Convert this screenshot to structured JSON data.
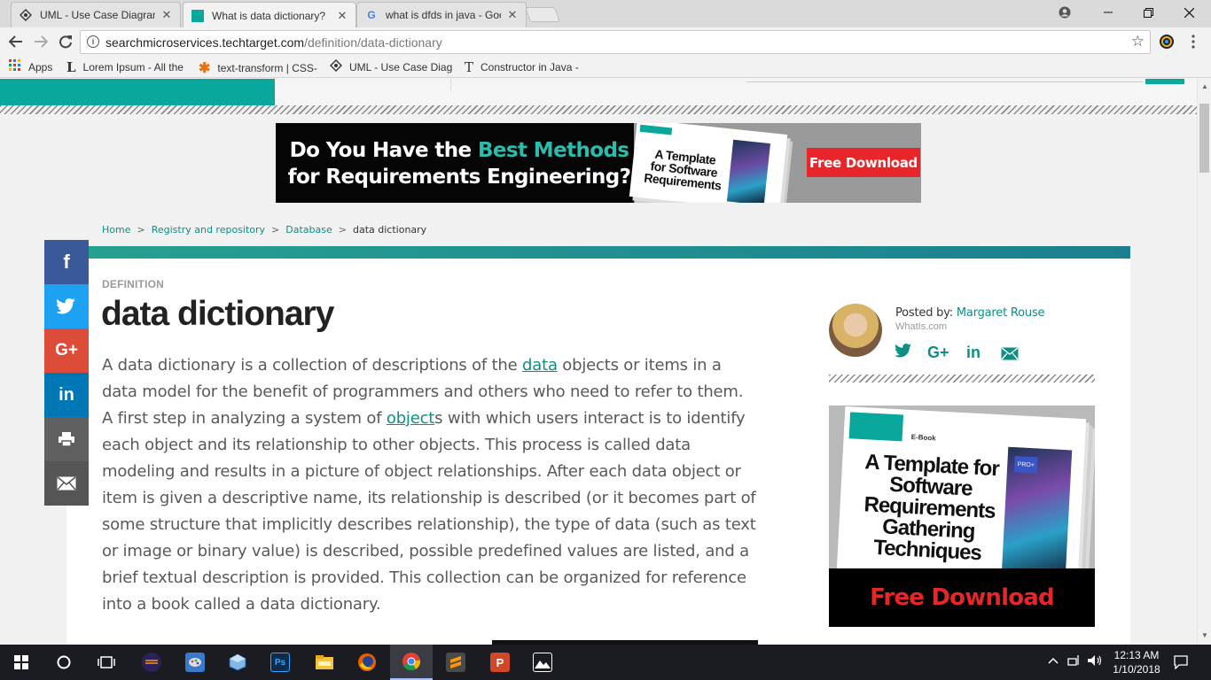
{
  "browser": {
    "tabs": [
      {
        "title": "UML - Use Case Diagram",
        "close": "✕"
      },
      {
        "title": "What is data dictionary?",
        "close": "✕"
      },
      {
        "title": "what is dfds in java - Goo",
        "close": "✕"
      }
    ],
    "address": {
      "host": "searchmicroservices.techtarget.com",
      "path": "/definition/data-dictionary"
    },
    "bookmarks": [
      {
        "label": "Apps"
      },
      {
        "label": "Lorem Ipsum - All the"
      },
      {
        "label": "text-transform | CSS-"
      },
      {
        "label": "UML - Use Case Diag"
      },
      {
        "label": "Constructor in Java -"
      }
    ]
  },
  "banner_ad": {
    "headline_pre": "Do You Have the ",
    "headline_accent": "Best Methods",
    "headline_post": " for Requirements Engineering?",
    "book_title": "A Template for Software Requirements",
    "cta": "Free Download"
  },
  "breadcrumb": [
    "Home",
    "Registry and repository",
    "Database",
    "data dictionary"
  ],
  "breadcrumb_sep": ">",
  "kicker": "DEFINITION",
  "title": "data dictionary",
  "article": {
    "p1": "A data dictionary is a collection of descriptions of the ",
    "link1": "data",
    "p2": " objects or items in a data model for the benefit of programmers and others who need to refer to them. A first step in analyzing a system of ",
    "link2": "object",
    "p3": "s with which users interact is to identify each object and its relationship to other objects. This process is called data modeling and results in a picture of object relationships. After each data object or item is given a descriptive name, its relationship is described (or it becomes part of some structure that implicitly describes relationship), the type of data (such as text or image or binary value) is described, possible predefined values are listed, and a brief textual description is provided. This collection can be organized for reference into a book called a data dictionary."
  },
  "share": {
    "facebook": "f",
    "googleplus": "G+",
    "linkedin": "in"
  },
  "author": {
    "posted_by": "Posted by: ",
    "name": "Margaret Rouse",
    "org": "WhatIs.com"
  },
  "side_ad": {
    "ebook_tag": "E-Book",
    "pro_tag": "PRO+",
    "book_title": "A Template for Software Requirements Gathering Techniques",
    "cta": "Free Download"
  },
  "taskbar": {
    "clock_time": "12:13 AM",
    "clock_date": "1/10/2018",
    "icons": [
      "windows-start-icon",
      "cortana-icon",
      "task-view-icon",
      "eclipse-icon",
      "paint-icon",
      "virtualbox-icon",
      "photoshop-icon",
      "file-explorer-icon",
      "firefox-icon",
      "chrome-icon",
      "sublime-icon",
      "powerpoint-icon",
      "photos-icon"
    ]
  },
  "colors": {
    "teal": "#0aa89c",
    "link": "#0d8f85",
    "cta_red": "#e8262a"
  }
}
